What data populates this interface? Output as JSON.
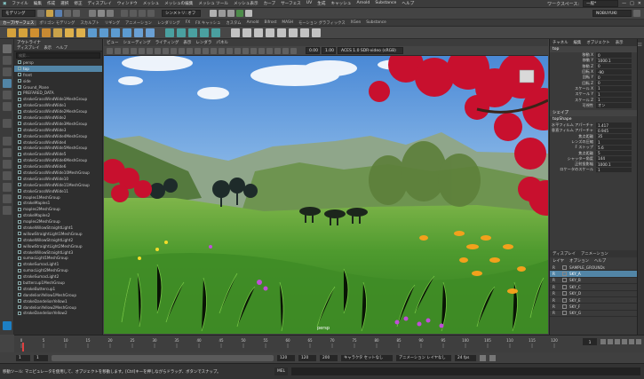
{
  "menubar": {
    "items": [
      "ファイル",
      "編集",
      "作成",
      "選択",
      "修正",
      "ディスプレイ",
      "ウィンドウ",
      "メッシュ",
      "メッシュの編集",
      "メッシュ ツール",
      "メッシュ表示",
      "カーブ",
      "サーフェス",
      "UV",
      "生成",
      "キャッシュ",
      "Arnold",
      "Substance",
      "ヘルプ"
    ],
    "workspace_label": "ワークスペース:",
    "workspace_value": "一般*"
  },
  "toolbar": {
    "mode": "モデリング",
    "symmetry": "シンメトリ: オフ",
    "user": "NOBUYUKI"
  },
  "shelf_tabs": [
    "カーブ/サーフェス",
    "ポリゴン モデリング",
    "スカルプト",
    "リギング",
    "アニメーション",
    "レンダリング",
    "FX",
    "FX キャッシュ",
    "カスタム",
    "Arnold",
    "Bifrost",
    "MASH",
    "モーション グラフィックス",
    "XGen",
    "Substance"
  ],
  "outliner": {
    "title": "アウトライナ",
    "menu": [
      "ディスプレイ",
      "表示",
      "ヘルプ"
    ],
    "search_placeholder": "検索...",
    "items": [
      "persp",
      "top",
      "front",
      "side",
      "Ground_Plane",
      "PREFARED_DATA",
      "strokeGrassWindWide1MeshGroup",
      "strokeGrassWindWide1",
      "strokeGrassWindWide2MeshGroup",
      "strokeGrassWindWide2",
      "strokeGrassWindWide3MeshGroup",
      "strokeGrassWindWide3",
      "strokeGrassWindWide4MeshGroup",
      "strokeGrassWindWide4",
      "strokeGrassWindWide5MeshGroup",
      "strokeGrassWindWide5",
      "strokeGrassWindWide6MeshGroup",
      "strokeGrassWindWide6",
      "strokeGrassWindWide10MeshGroup",
      "strokeGrassWindWide10",
      "strokeGrassWindWide11MeshGroup",
      "strokeGrassWindWide11",
      "maples1MeshGroup",
      "strokeMaples1",
      "maples2MeshGroup",
      "strokeMaples2",
      "maples2MeshGroup",
      "strokeWillowStraightLight1",
      "willowStraightLight1MeshGroup",
      "strokeWillowStraightLight2",
      "willowStraightLight2MeshGroup",
      "strokeWillowStraightLight3",
      "sumacLight1MeshGroup",
      "strokeSumacLight1",
      "sumacLight2MeshGroup",
      "strokeSumacLight2",
      "buttercup1MeshGroup",
      "strokeButtercup1",
      "dandelionYellow1MeshGroup",
      "strokeDandelionYellow1",
      "dandelionYellow2MeshGroup",
      "strokeDandelionYellow2"
    ],
    "selected_index": 1
  },
  "viewport": {
    "menu": [
      "ビュー",
      "シェーディング",
      "ライティング",
      "表示",
      "レンダラ",
      "パネル"
    ],
    "colorspace": "ACES 1.0 SDR-video (sRGB)",
    "camera_label": "persp"
  },
  "channelbox": {
    "tabs": [
      "チャネル",
      "編集",
      "オブジェクト",
      "表示"
    ],
    "object": "top",
    "channels": [
      {
        "label": "移動 X",
        "value": "0"
      },
      {
        "label": "移動 Y",
        "value": "1000.1"
      },
      {
        "label": "移動 Z",
        "value": "0"
      },
      {
        "label": "回転 X",
        "value": "-90"
      },
      {
        "label": "回転 Y",
        "value": "0"
      },
      {
        "label": "回転 Z",
        "value": "0"
      },
      {
        "label": "スケール X",
        "value": "1"
      },
      {
        "label": "スケール Y",
        "value": "1"
      },
      {
        "label": "スケール Z",
        "value": "1"
      },
      {
        "label": "可視性",
        "value": "オン"
      }
    ],
    "shapes_title": "シェイプ",
    "shape_name": "topShape",
    "shape_channels": [
      {
        "label": "水平フィルム アパーチャ",
        "value": "1.417"
      },
      {
        "label": "垂直フィルム アパーチャ",
        "value": "0.945"
      },
      {
        "label": "焦点距離",
        "value": "35"
      },
      {
        "label": "レンズの圧縮",
        "value": "1"
      },
      {
        "label": "F ストップ",
        "value": "5.6"
      },
      {
        "label": "焦点距離",
        "value": "5"
      },
      {
        "label": "シャッター角度",
        "value": "144"
      },
      {
        "label": "正射投影幅",
        "value": "1000.1"
      },
      {
        "label": "ロケータのスケール",
        "value": "1"
      }
    ]
  },
  "layers": {
    "tabs": [
      "ディスプレイ",
      "アニメーション"
    ],
    "menu": [
      "レイヤ",
      "オプション",
      "ヘルプ"
    ],
    "items": [
      {
        "flag": "R",
        "name": "SAMPLE_GROUNDs"
      },
      {
        "flag": "R",
        "name": "SKY_A"
      },
      {
        "flag": "R",
        "name": "SKY_B"
      },
      {
        "flag": "R",
        "name": "SKY_C"
      },
      {
        "flag": "R",
        "name": "SKY_D"
      },
      {
        "flag": "R",
        "name": "SKY_E"
      },
      {
        "flag": "R",
        "name": "SKY_F"
      },
      {
        "flag": "R",
        "name": "SKY_G"
      }
    ],
    "selected_index": 1
  },
  "timeslider": {
    "ticks": [
      "0",
      "5",
      "10",
      "15",
      "20",
      "25",
      "30",
      "35",
      "40",
      "45",
      "50",
      "55",
      "60",
      "65",
      "70",
      "75",
      "80",
      "85",
      "90",
      "95",
      "100",
      "105",
      "110",
      "115",
      "120"
    ],
    "current_frame": "1"
  },
  "range": {
    "start": "1",
    "start_inner": "1",
    "end_inner": "120",
    "end": "120",
    "end2": "200",
    "character_set": "キャラクタ セットなし",
    "anim_layer": "アニメーション レイヤなし",
    "fps": "24 fps"
  },
  "status": {
    "message": "移動ツール: マニピュレータを使用して、オブジェクトを移動します。[Ctrl]キーを押しながらドラッグ、ボタンでスナップ。",
    "mel": "MEL"
  },
  "colors": {
    "selection": "#5285a6",
    "panel": "#444444",
    "sky": "#6fa6e0",
    "maple_red": "#c8102e",
    "grass": "#4caf3a"
  }
}
